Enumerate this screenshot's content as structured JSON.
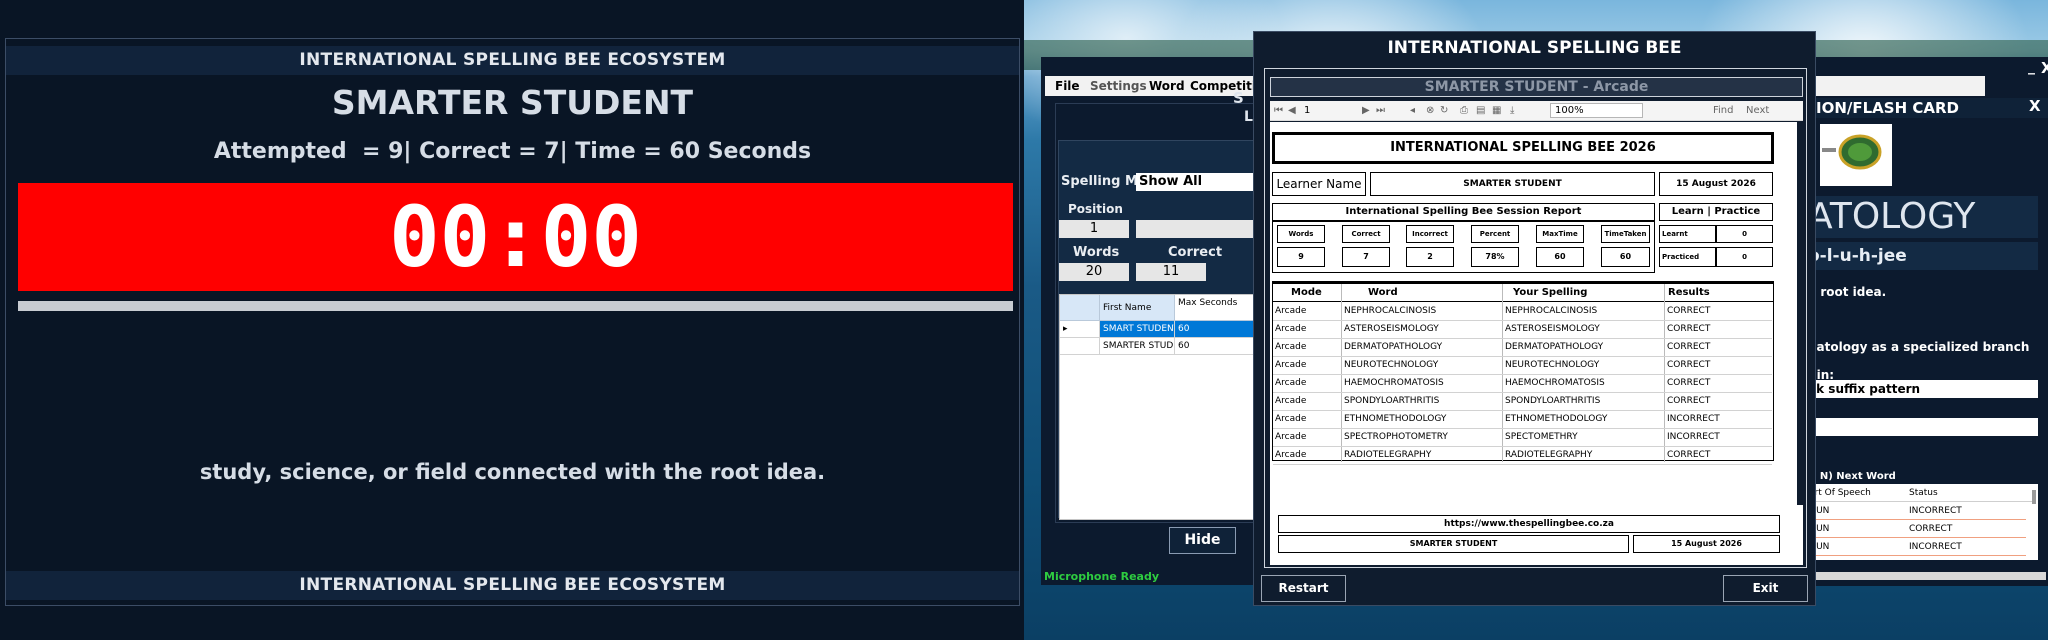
{
  "left": {
    "eco_header": "INTERNATIONAL SPELLING BEE ECOSYSTEM",
    "student": "SMARTER STUDENT",
    "stats": "Attempted  = 9| Correct = 7| Time = 60 Seconds",
    "timer": "00:00",
    "clue": "study, science, or field connected with the root idea.",
    "eco_footer": "INTERNATIONAL SPELLING BEE ECOSYSTEM"
  },
  "background_app": {
    "min_label": "_",
    "close_label": "X",
    "menu": [
      "File",
      "Settings",
      "Word",
      "Competition"
    ],
    "panel_banner": "S",
    "panel_banner2": "Le",
    "spelling_mode_label": "Spelling Mode",
    "spelling_mode_value": "Show All",
    "position_label": "Position",
    "position_value": "1",
    "words_label": "Words",
    "words_value": "20",
    "correct_label": "Correct",
    "correct_value": "11",
    "grid": {
      "headers": [
        "First Name",
        "Max Seconds"
      ],
      "rows": [
        {
          "marker": "▸",
          "name": "SMART STUDENT",
          "max": "60"
        },
        {
          "marker": "",
          "name": "SMARTER STUD...",
          "max": "60"
        }
      ]
    },
    "hide_label": "Hide",
    "mic_status": "Microphone Ready"
  },
  "flash_card": {
    "title": "ION/FLASH CARD",
    "close_label": "X",
    "word": "ATOLOGY",
    "phonetic": "o-l-u-h-jee",
    "definition": "e root idea.",
    "line2": "natology as a specialized branch",
    "origin_label": "gin:",
    "origin_value": "ek suffix pattern",
    "next_label": "+ N) Next Word",
    "grid_headers": [
      "art Of Speech",
      "Status"
    ],
    "grid_rows": [
      {
        "pos": "OUN",
        "status": "INCORRECT"
      },
      {
        "pos": "OUN",
        "status": "CORRECT"
      },
      {
        "pos": "OUN",
        "status": "INCORRECT"
      }
    ]
  },
  "report": {
    "window_title": "INTERNATIONAL SPELLING BEE",
    "mode_title": "SMARTER STUDENT  - Arcade",
    "toolbar": {
      "page": "1",
      "zoom": "100%",
      "find": "Find",
      "next": "Next"
    },
    "heading": "INTERNATIONAL SPELLING BEE 2026",
    "learner_label": "Learner Name",
    "learner_name": "SMARTER STUDENT",
    "date": "15 August 2026",
    "session_title": "International Spelling Bee Session Report",
    "learn_title": "Learn | Practice",
    "summary_headers": [
      "Words",
      "Correct",
      "Incorrect",
      "Percent",
      "MaxTime",
      "TimeTaken"
    ],
    "summary_values": [
      "9",
      "7",
      "2",
      "78%",
      "60",
      "60"
    ],
    "learnt_label": "Learnt",
    "learnt_value": "0",
    "practiced_label": "Practiced",
    "practiced_value": "0",
    "table_headers": [
      "Mode",
      "Word",
      "Your Spelling",
      "Results"
    ],
    "rows": [
      {
        "mode": "Arcade",
        "word": "NEPHROCALCINOSIS",
        "spelling": "NEPHROCALCINOSIS",
        "result": "CORRECT"
      },
      {
        "mode": "Arcade",
        "word": "ASTEROSEISMOLOGY",
        "spelling": "ASTEROSEISMOLOGY",
        "result": "CORRECT"
      },
      {
        "mode": "Arcade",
        "word": "DERMATOPATHOLOGY",
        "spelling": "DERMATOPATHOLOGY",
        "result": "CORRECT"
      },
      {
        "mode": "Arcade",
        "word": "NEUROTECHNOLOGY",
        "spelling": "NEUROTECHNOLOGY",
        "result": "CORRECT"
      },
      {
        "mode": "Arcade",
        "word": "HAEMOCHROMATOSIS",
        "spelling": "HAEMOCHROMATOSIS",
        "result": "CORRECT"
      },
      {
        "mode": "Arcade",
        "word": "SPONDYLOARTHRITIS",
        "spelling": "SPONDYLOARTHRITIS",
        "result": "CORRECT"
      },
      {
        "mode": "Arcade",
        "word": "ETHNOMETHODOLOGY",
        "spelling": "ETHNOMETHODOLOGY",
        "result": "INCORRECT"
      },
      {
        "mode": "Arcade",
        "word": "SPECTROPHOTOMETRY",
        "spelling": "SPECTOMETHRY",
        "result": "INCORRECT"
      },
      {
        "mode": "Arcade",
        "word": "RADIOTELEGRAPHY",
        "spelling": "RADIOTELEGRAPHY",
        "result": "CORRECT"
      }
    ],
    "website": "https://www.thespellingbee.co.za",
    "footer_name": "SMARTER STUDENT",
    "footer_date": "15 August 2026",
    "restart_label": "Restart",
    "exit_label": "Exit"
  }
}
